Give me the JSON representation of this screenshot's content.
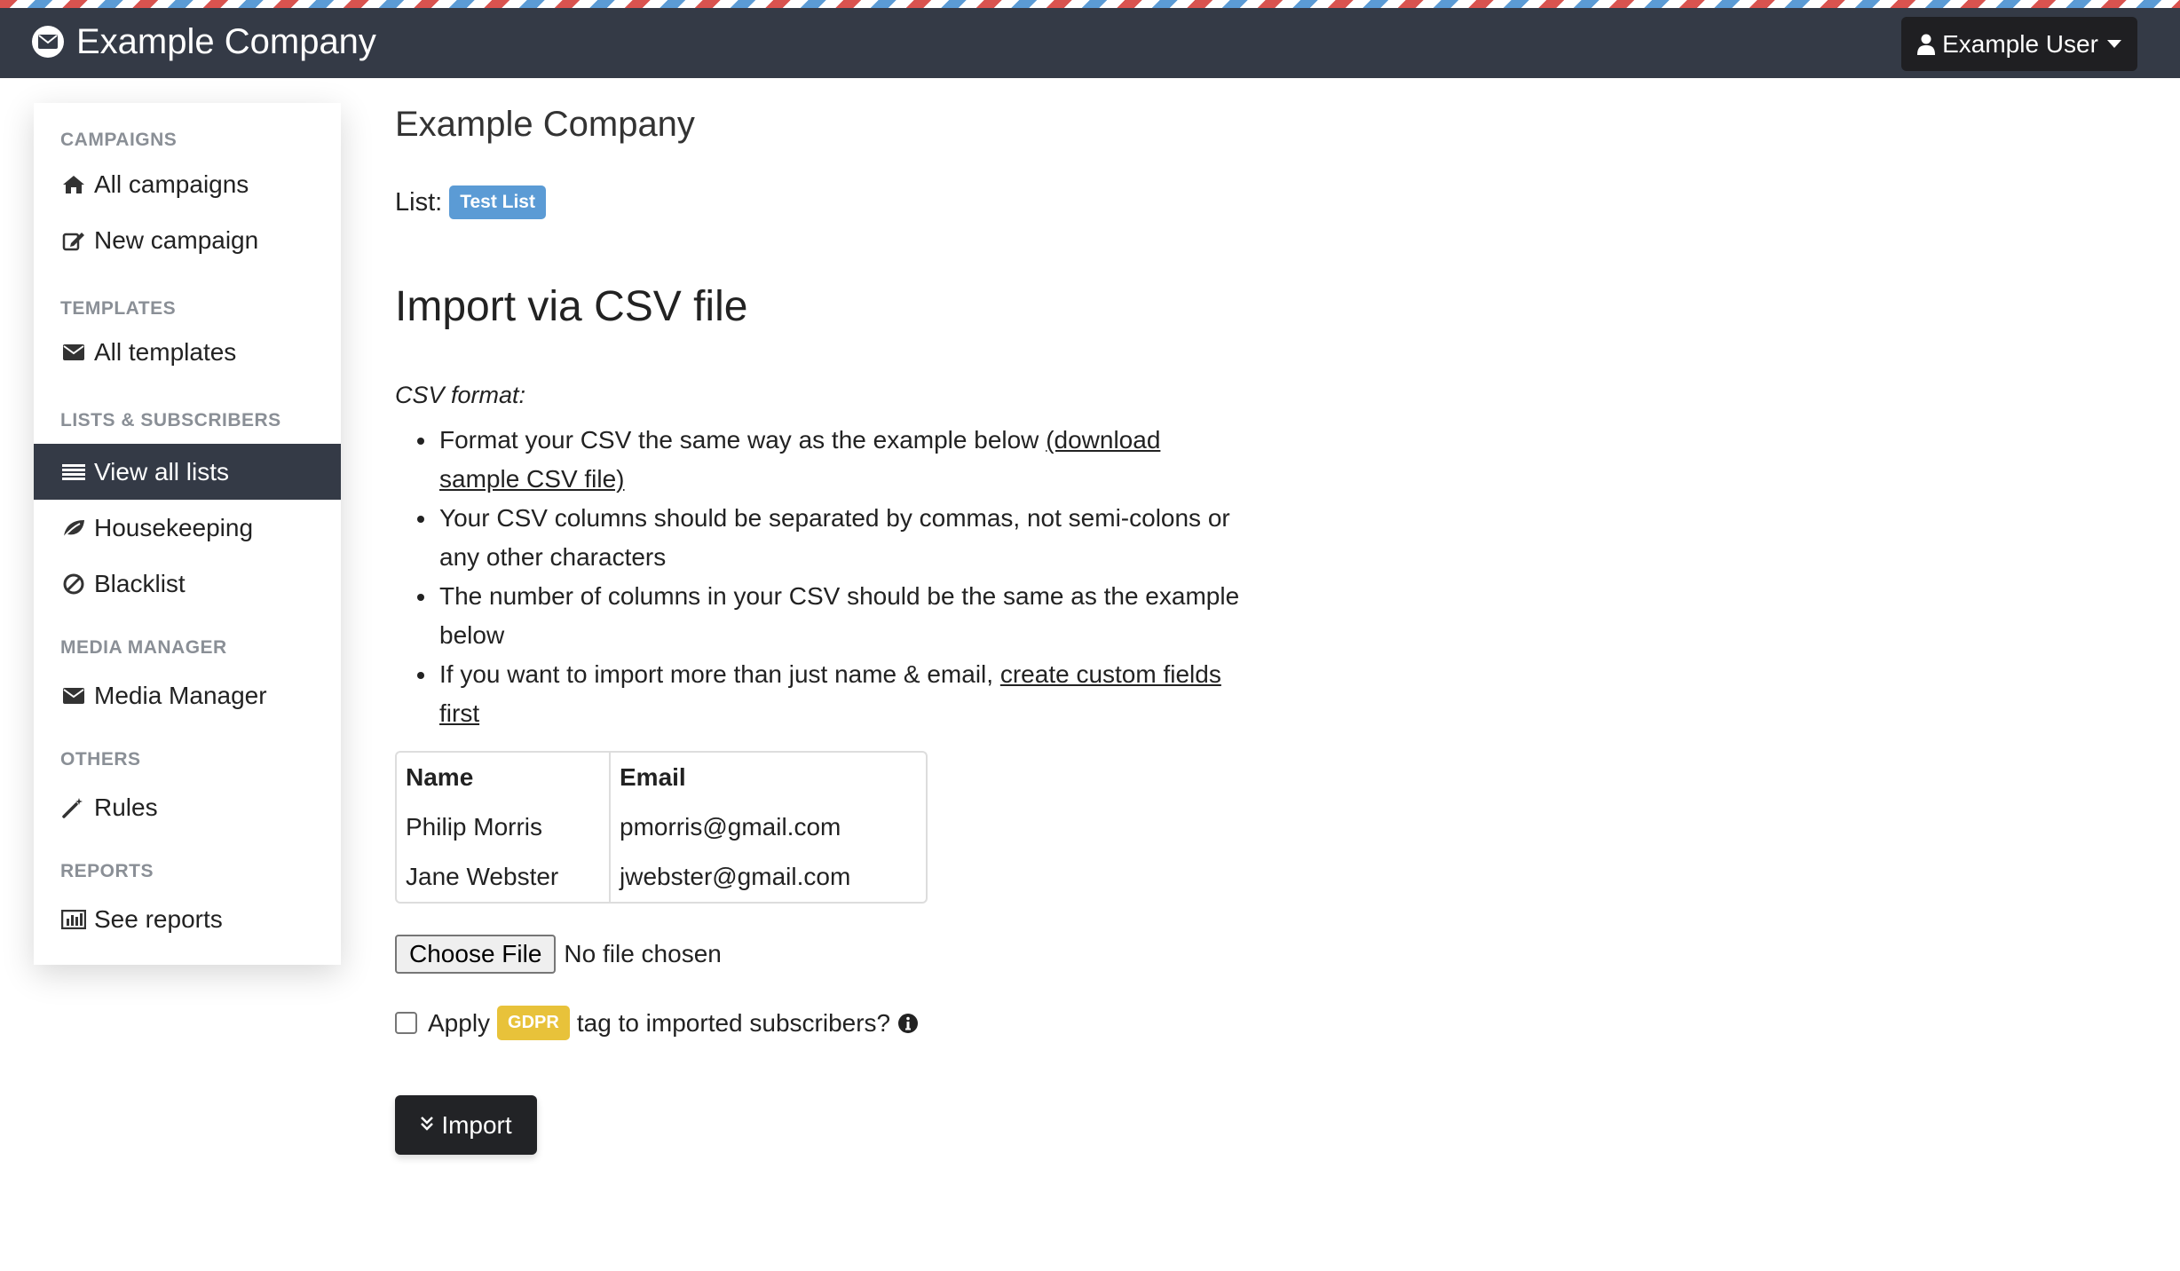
{
  "header": {
    "brand_title": "Example Company",
    "user_label": "Example User",
    "colors": {
      "topbar": "#343a46",
      "stripe_red": "#d9534f",
      "stripe_blue": "#5b9bd5"
    }
  },
  "sidebar": {
    "headings": {
      "campaigns": "CAMPAIGNS",
      "templates": "TEMPLATES",
      "lists": "LISTS & SUBSCRIBERS",
      "media": "MEDIA MANAGER",
      "others": "OTHERS",
      "reports": "REPORTS"
    },
    "items": {
      "all_campaigns": "All campaigns",
      "new_campaign": "New campaign",
      "all_templates": "All templates",
      "view_all_lists": "View all lists",
      "housekeeping": "Housekeeping",
      "blacklist": "Blacklist",
      "media_manager": "Media Manager",
      "rules": "Rules",
      "see_reports": "See reports"
    },
    "active_item": "View all lists"
  },
  "main": {
    "page_title": "Example Company",
    "list_label": "List:",
    "list_badge": "Test List",
    "import_title": "Import via CSV file",
    "csv_format_label": "CSV format:",
    "bullets": {
      "b1_text": "Format your CSV the same way as the example below ",
      "b1_link": "(download sample CSV file)",
      "b2_text": "Your CSV columns should be separated by commas, not semi-colons or any other characters",
      "b3_text": "The number of columns in your CSV should be the same as the example below",
      "b4_text": "If you want to import more than just name & email, ",
      "b4_link": "create custom fields first"
    },
    "sample_table": {
      "headers": {
        "name": "Name",
        "email": "Email"
      },
      "rows": [
        {
          "name": "Philip Morris",
          "email": "pmorris@gmail.com"
        },
        {
          "name": "Jane Webster",
          "email": "jwebster@gmail.com"
        }
      ]
    },
    "file_input": {
      "button_label": "Choose File",
      "status": "No file chosen"
    },
    "gdpr": {
      "apply_label": "Apply",
      "badge": "GDPR",
      "suffix": "tag to imported subscribers?",
      "checked": false
    },
    "import_button": "Import"
  }
}
